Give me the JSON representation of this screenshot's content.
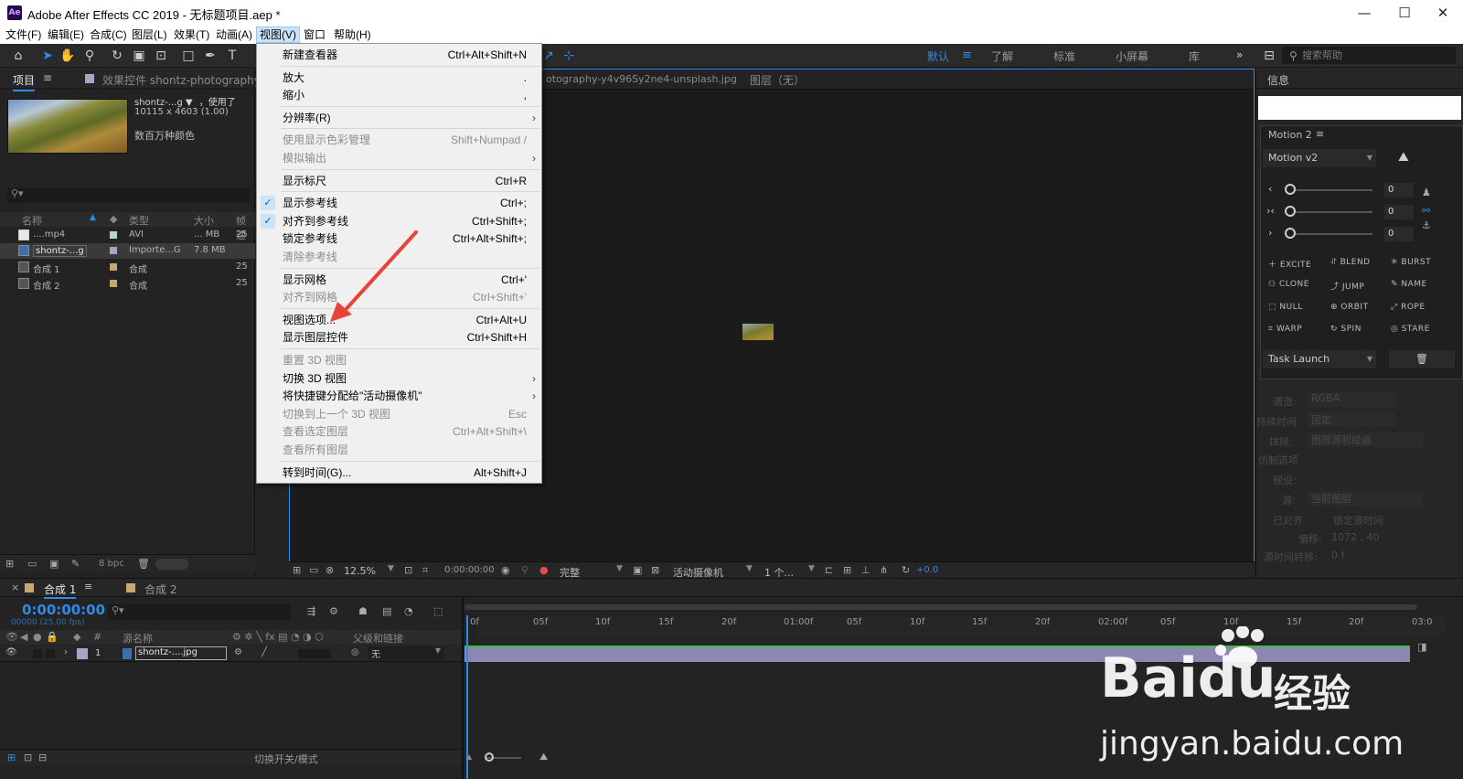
{
  "window": {
    "title": "Adobe After Effects CC 2019 - 无标题项目.aep *",
    "app_icon": "Ae",
    "minimize": "—",
    "maximize": "☐",
    "close": "✕"
  },
  "menubar": [
    "文件(F)",
    "编辑(E)",
    "合成(C)",
    "图层(L)",
    "效果(T)",
    "动画(A)",
    "视图(V)",
    "窗口",
    "帮助(H)"
  ],
  "workspaces": {
    "items": [
      "默认",
      "了解",
      "标准",
      "小屏幕",
      "库"
    ],
    "active": "默认",
    "search_placeholder": "搜索帮助"
  },
  "project_panel": {
    "tab": "项目",
    "effects_tab": "效果控件 shontz-photography-y4",
    "selected_name": "shontz-...g ▼",
    "used_label": "，使用了",
    "dimensions": "10115 x 4603 (1.00)",
    "color_info": "数百万种颜色",
    "columns": {
      "name": "名称",
      "type": "类型",
      "size": "大小",
      "fps": "帧速"
    },
    "rows": [
      {
        "name": "....mp4",
        "type": "AVI",
        "size": "... MB",
        "fps": "25",
        "swatch": "#b9d6c8"
      },
      {
        "name": "shontz-...g",
        "type": "Importe...G",
        "size": "7.8 MB",
        "fps": "",
        "swatch": "#aaa3c8"
      },
      {
        "name": "合成 1",
        "type": "合成",
        "size": "",
        "fps": "25",
        "swatch": "#c8a86e"
      },
      {
        "name": "合成 2",
        "type": "合成",
        "size": "",
        "fps": "25",
        "swatch": "#c8a86e"
      }
    ],
    "bpc": "8 bpc"
  },
  "viewer": {
    "tab_file": "otography-y4v96Sy2ne4-unsplash.jpg",
    "layer_tab": "图层（无）",
    "zoom": "12.5%",
    "timecode": "0:00:00:00",
    "resolution": "完整",
    "camera": "活动摄像机",
    "views": "1 个...",
    "exposure": "+0.0"
  },
  "right_panel": {
    "info_tab": "信息",
    "motion": {
      "tab": "Motion 2",
      "preset": "Motion v2",
      "values": [
        "0",
        "0",
        "0"
      ],
      "buttons": [
        "EXCITE",
        "BLEND",
        "BURST",
        "CLONE",
        "JUMP",
        "NAME",
        "NULL",
        "ORBIT",
        "ROPE",
        "WARP",
        "SPIN",
        "STARE"
      ],
      "task": "Task Launch"
    },
    "faded": {
      "channel_label": "通道:",
      "channel": "RGBA",
      "time_label": "持续时间:",
      "time": "固定",
      "erase_label": "抹除:",
      "erase": "图层源和绘画",
      "clone_label": "仿制选项",
      "preset_label": "预设:",
      "source_label": "源:",
      "source": "当前图层",
      "aligned": "已对齐",
      "lock": "锁定源时间",
      "offset_label": "偏移:",
      "offset": "1072 , 40",
      "shift_label": "源时间转移:",
      "shift": "0 f"
    }
  },
  "timeline": {
    "tabs": [
      "合成 1",
      "合成 2"
    ],
    "timecode": "0:00:00:00",
    "fps_info": "00000 (25.00 fps)",
    "col_source": "源名称",
    "col_parent": "父级和链接",
    "layer": {
      "num": "1",
      "name": "shontz-....jpg",
      "parent": "无"
    },
    "ruler": [
      "0f",
      "05f",
      "10f",
      "15f",
      "20f",
      "01:00f",
      "05f",
      "10f",
      "15f",
      "20f",
      "02:00f",
      "05f",
      "10f",
      "15f",
      "20f",
      "03:0"
    ],
    "toggle_label": "切换开关/模式"
  },
  "view_menu": {
    "items": [
      {
        "label": "新建查看器",
        "shortcut": "Ctrl+Alt+Shift+N",
        "dis": false
      },
      {
        "sep": true
      },
      {
        "label": "放大",
        "shortcut": ".",
        "dis": false
      },
      {
        "label": "缩小",
        "shortcut": ",",
        "dis": false
      },
      {
        "sep": true
      },
      {
        "label": "分辨率(R)",
        "arrow": true,
        "dis": false
      },
      {
        "sep": true
      },
      {
        "label": "使用显示色彩管理",
        "shortcut": "Shift+Numpad /",
        "dis": true
      },
      {
        "label": "模拟输出",
        "arrow": true,
        "dis": true
      },
      {
        "sep": true
      },
      {
        "label": "显示标尺",
        "shortcut": "Ctrl+R",
        "dis": false
      },
      {
        "sep": true
      },
      {
        "label": "显示参考线",
        "shortcut": "Ctrl+;",
        "checked": true,
        "dis": false
      },
      {
        "label": "对齐到参考线",
        "shortcut": "Ctrl+Shift+;",
        "checked": true,
        "dis": false
      },
      {
        "label": "锁定参考线",
        "shortcut": "Ctrl+Alt+Shift+;",
        "dis": false
      },
      {
        "label": "清除参考线",
        "dis": true
      },
      {
        "sep": true
      },
      {
        "label": "显示网格",
        "shortcut": "Ctrl+'",
        "dis": false
      },
      {
        "label": "对齐到网格",
        "shortcut": "Ctrl+Shift+'",
        "dis": true
      },
      {
        "sep": true
      },
      {
        "label": "视图选项...",
        "shortcut": "Ctrl+Alt+U",
        "dis": false
      },
      {
        "label": "显示图层控件",
        "shortcut": "Ctrl+Shift+H",
        "dis": false
      },
      {
        "sep": true
      },
      {
        "label": "重置 3D 视图",
        "dis": true
      },
      {
        "label": "切换 3D 视图",
        "arrow": true,
        "dis": false
      },
      {
        "label": "将快捷键分配给\"活动摄像机\"",
        "arrow": true,
        "dis": false
      },
      {
        "label": "切换到上一个 3D 视图",
        "shortcut": "Esc",
        "dis": true
      },
      {
        "label": "查看选定图层",
        "shortcut": "Ctrl+Alt+Shift+\\",
        "dis": true
      },
      {
        "label": "查看所有图层",
        "dis": true
      },
      {
        "sep": true
      },
      {
        "label": "转到时间(G)...",
        "shortcut": "Alt+Shift+J",
        "dis": false
      }
    ]
  },
  "watermark": {
    "brand": "Bai",
    "brand2": "du",
    "cn": "经验",
    "url": "jingyan.baidu.com"
  },
  "colors": {
    "accent": "#2d8ceb",
    "annotation_arrow": "#e8423a",
    "menu_bg": "#f0f0f0"
  }
}
